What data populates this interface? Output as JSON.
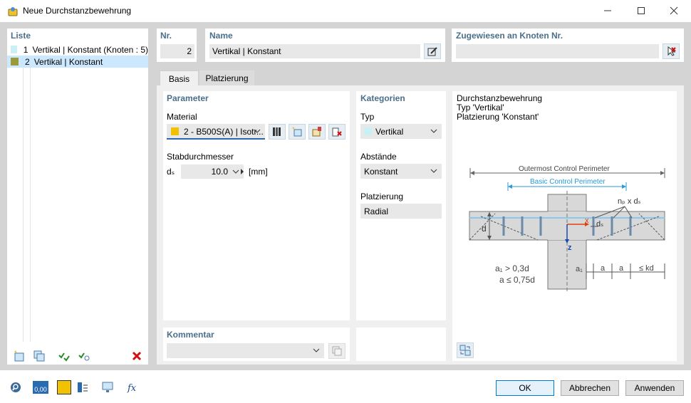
{
  "window": {
    "title": "Neue Durchstanzbewehrung"
  },
  "list": {
    "header": "Liste",
    "items": [
      {
        "number": "1",
        "label": "Vertikal | Konstant (Knoten : 5)",
        "color": "#c8f0f5"
      },
      {
        "number": "2",
        "label": "Vertikal | Konstant",
        "color": "#9a9a3a"
      }
    ]
  },
  "nr": {
    "header": "Nr.",
    "value": "2"
  },
  "name": {
    "header": "Name",
    "value": "Vertikal | Konstant"
  },
  "assigned": {
    "header": "Zugewiesen an Knoten Nr.",
    "value": ""
  },
  "tabs": [
    {
      "label": "Basis"
    },
    {
      "label": "Platzierung"
    }
  ],
  "parameter": {
    "header": "Parameter",
    "material_label": "Material",
    "material_value": "2 - B500S(A) | Isotr...",
    "material_color": "#f2c200",
    "diameter_label": "Stabdurchmesser",
    "diameter_symbol": "dₛ",
    "diameter_value": "10.0",
    "diameter_unit": "[mm]"
  },
  "categories": {
    "header": "Kategorien",
    "type_label": "Typ",
    "type_value": "Vertikal",
    "spacing_label": "Abstände",
    "spacing_value": "Konstant",
    "placement_label": "Platzierung",
    "placement_value": "Radial"
  },
  "diagram": {
    "line1": "Durchstanzbewehrung",
    "line2": "Typ 'Vertikal'",
    "line3": "Platzierung 'Konstant'",
    "outer_label": "Outermost Control Perimeter",
    "basic_label": "Basic Control Perimeter",
    "np_label": "nₚ x dₛ",
    "ds_label": "dₛ",
    "d_label": "d",
    "x_label": "x",
    "z_label": "z",
    "a1_cond": "a₁ > 0,3d",
    "a_cond": "a ≤ 0,75d",
    "dim_a1": "a₁",
    "dim_a": "a",
    "dim_a2": "a",
    "dim_kd": "≤ kd"
  },
  "comment": {
    "header": "Kommentar",
    "value": ""
  },
  "buttons": {
    "ok": "OK",
    "cancel": "Abbrechen",
    "apply": "Anwenden"
  },
  "bottom_toolbar": {
    "value_icon_text": "0,00"
  }
}
